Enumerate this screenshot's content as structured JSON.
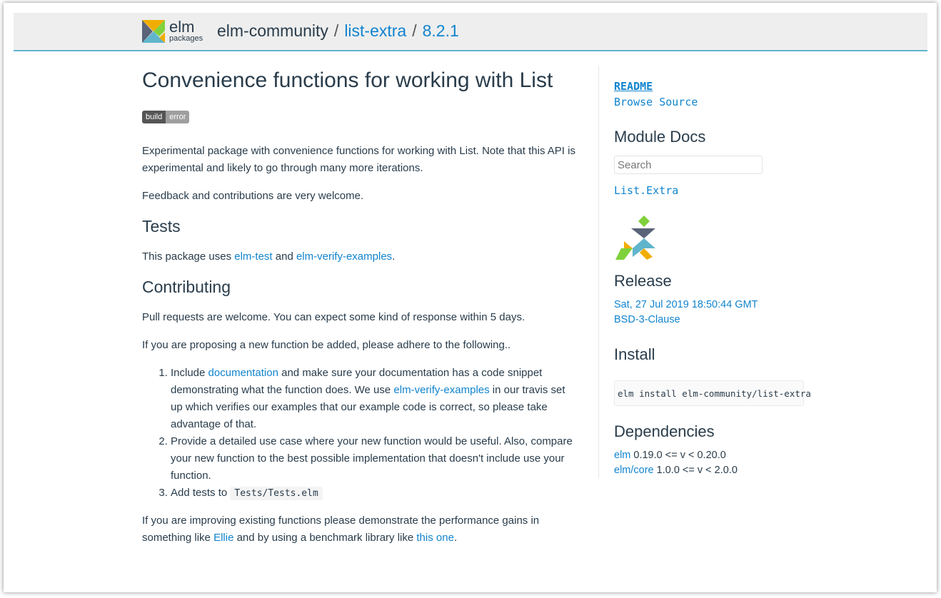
{
  "header": {
    "logo_word": "elm",
    "logo_sub": "packages",
    "author": "elm-community",
    "package": "list-extra",
    "version": "8.2.1",
    "separator": "/"
  },
  "main": {
    "title": "Convenience functions for working with List",
    "badge": {
      "left": "build",
      "right": "error"
    },
    "intro_text": "Experimental package with convenience functions for working with List. Note that this API is experimental and likely to go through many more iterations.",
    "feedback_text": "Feedback and contributions are very welcome.",
    "tests_heading": "Tests",
    "tests_prefix": "This package uses ",
    "tests_link1": "elm-test",
    "tests_and": " and ",
    "tests_link2": "elm-verify-examples",
    "tests_suffix": ".",
    "contributing_heading": "Contributing",
    "pr_text": "Pull requests are welcome. You can expect some kind of response within 5 days.",
    "proposing_text": "If you are proposing a new function be added, please adhere to the following..",
    "list": {
      "item1_prefix": "Include ",
      "item1_link1": "documentation",
      "item1_mid": " and make sure your documentation has a code snippet demonstrating what the function does. We use ",
      "item1_link2": "elm-verify-examples",
      "item1_suffix": " in our travis set up which verifies our examples that our example code is correct, so please take advantage of that.",
      "item2": "Provide a detailed use case where your new function would be useful. Also, compare your new function to the best possible implementation that doesn't include use your function.",
      "item3_prefix": "Add tests to ",
      "item3_code": "Tests/Tests.elm"
    },
    "improving_prefix": "If you are improving existing functions please demonstrate the performance gains in something like ",
    "improving_link1": "Ellie",
    "improving_mid": " and by using a benchmark library like ",
    "improving_link2": "this one",
    "improving_suffix": "."
  },
  "sidebar": {
    "readme": "README",
    "browse_source": "Browse Source",
    "module_docs_heading": "Module Docs",
    "search_placeholder": "Search",
    "module_link": "List.Extra",
    "release_heading": "Release",
    "release_date": "Sat, 27 Jul 2019 18:50:44 GMT",
    "license": "BSD-3-Clause",
    "install_heading": "Install",
    "install_command": "elm install elm-community/list-extra",
    "dependencies_heading": "Dependencies",
    "dependencies": [
      {
        "name": "elm",
        "range": " 0.19.0 <= v < 0.20.0"
      },
      {
        "name": "elm/core",
        "range": " 1.0.0 <= v < 2.0.0"
      }
    ]
  },
  "colors": {
    "link": "#1184ce",
    "text": "#293c4b",
    "header_bg": "#eeeeee",
    "header_border": "#60b5cc"
  }
}
